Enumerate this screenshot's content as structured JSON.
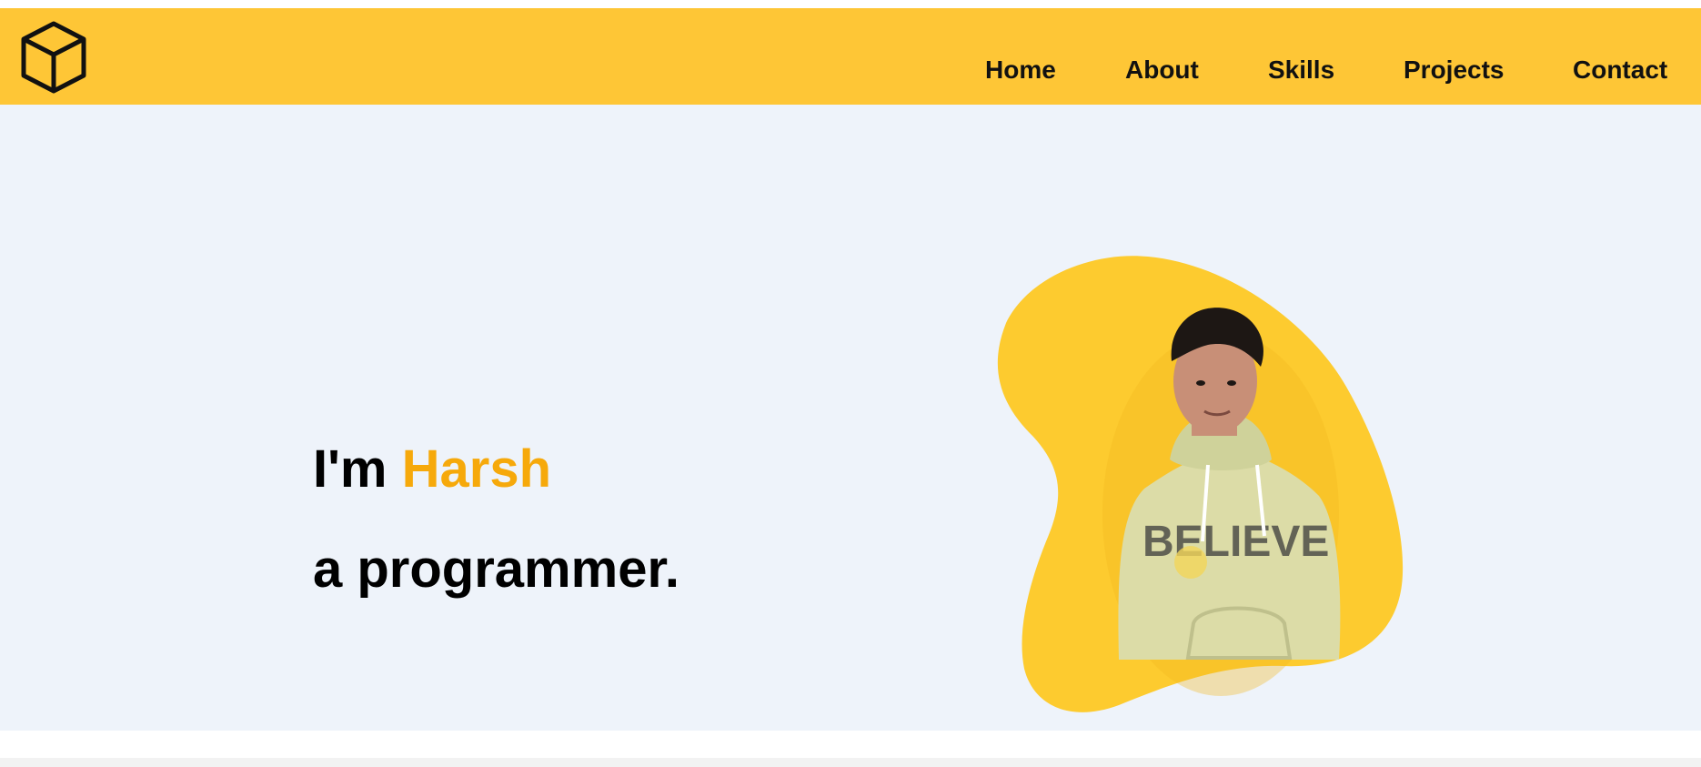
{
  "nav": {
    "logo_icon": "cube-icon",
    "links": [
      {
        "label": "Home"
      },
      {
        "label": "About"
      },
      {
        "label": "Skills"
      },
      {
        "label": "Projects"
      },
      {
        "label": "Contact"
      }
    ]
  },
  "hero": {
    "greeting": "I'm",
    "name": "Harsh",
    "tagline": "a programmer."
  },
  "colors": {
    "accent": "#fec636",
    "name_highlight": "#f6a90b",
    "hero_bg": "#eef3fa",
    "blob": "#fdcb2f"
  }
}
